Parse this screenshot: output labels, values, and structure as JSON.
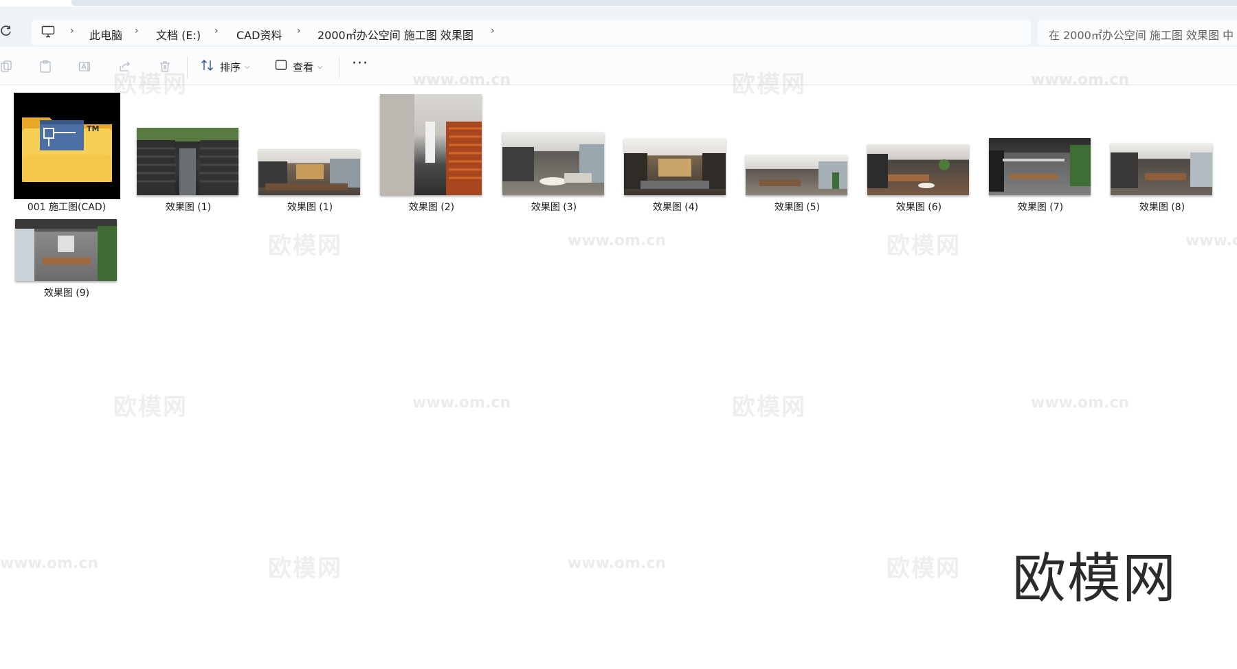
{
  "address": {
    "crumbs": [
      "此电脑",
      "文档 (E:)",
      "CAD资料",
      "2000㎡办公空间 施工图 效果图"
    ],
    "search_placeholder": "在 2000㎡办公空间 施工图 效果图 中"
  },
  "toolbar": {
    "sort_label": "排序",
    "view_label": "查看",
    "more_label": "···"
  },
  "files": [
    {
      "name": "001 施工图(CAD)",
      "type": "folder"
    },
    {
      "name": "效果图 (1)",
      "type": "image"
    },
    {
      "name": "效果图 (1)",
      "type": "image"
    },
    {
      "name": "效果图 (2)",
      "type": "image"
    },
    {
      "name": "效果图 (3)",
      "type": "image"
    },
    {
      "name": "效果图 (4)",
      "type": "image"
    },
    {
      "name": "效果图 (5)",
      "type": "image"
    },
    {
      "name": "效果图 (6)",
      "type": "image"
    },
    {
      "name": "效果图 (7)",
      "type": "image"
    },
    {
      "name": "效果图 (8)",
      "type": "image"
    },
    {
      "name": "效果图 (9)",
      "type": "image"
    }
  ],
  "watermark": {
    "brand": "欧模网",
    "url": "www.om.cn"
  },
  "colors": {
    "address_bg": "#eef3f8",
    "folder_yellow": "#f4c84b"
  }
}
